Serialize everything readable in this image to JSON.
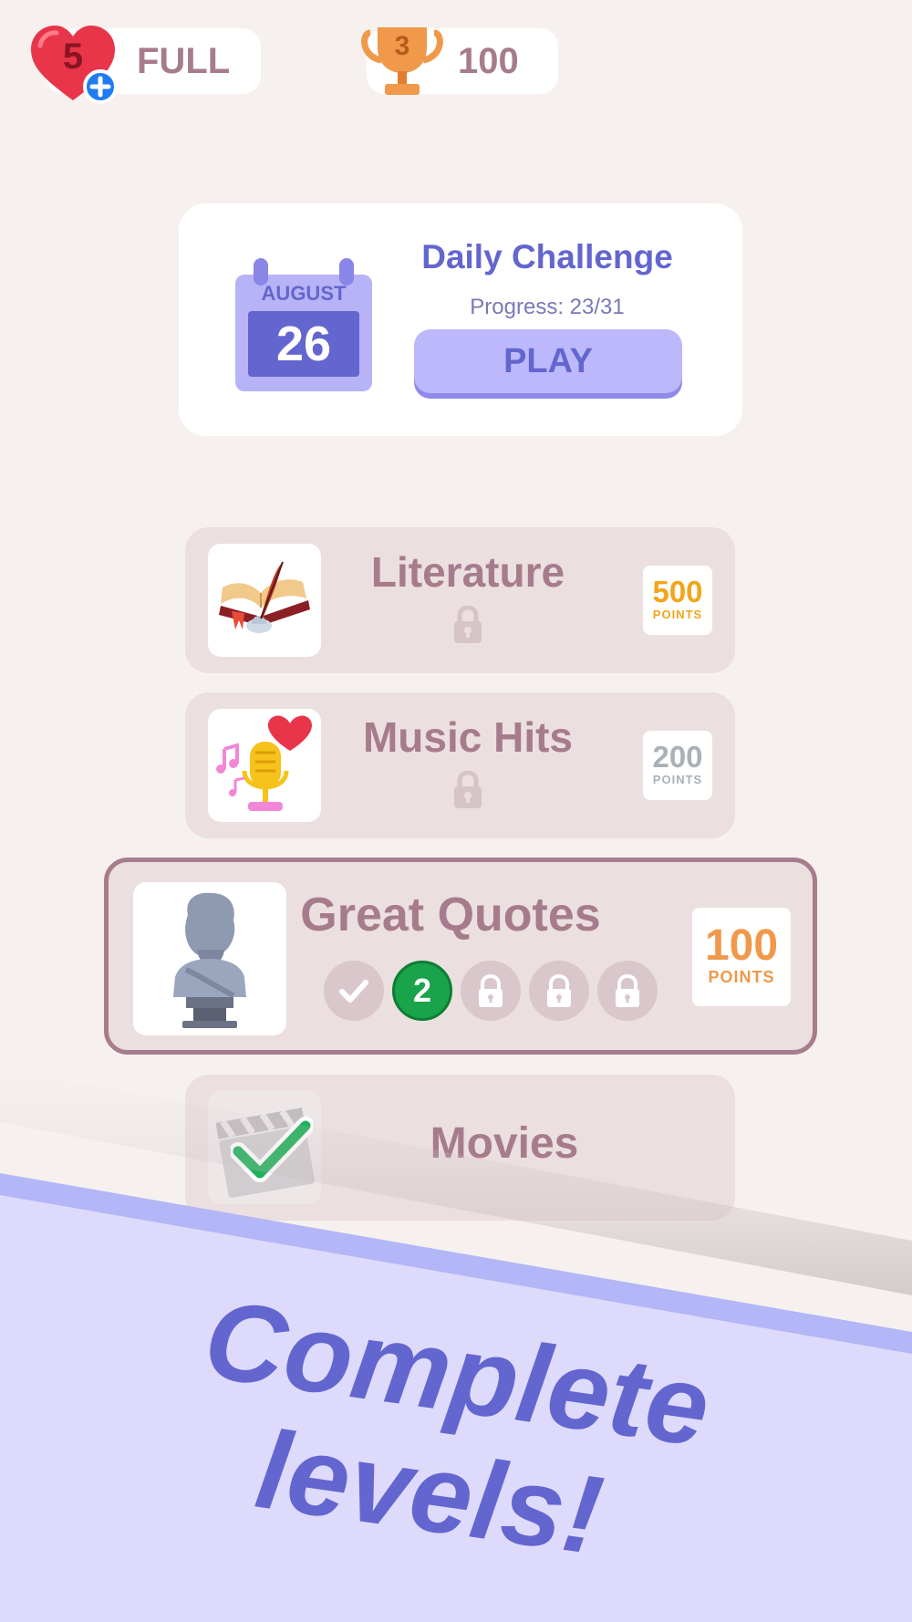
{
  "status": {
    "lives_count": "5",
    "lives_label": "FULL",
    "trophy_rank": "3",
    "score": "100"
  },
  "daily_challenge": {
    "month": "AUGUST",
    "day": "26",
    "title": "Daily Challenge",
    "progress": "Progress: 23/31",
    "play_label": "PLAY"
  },
  "levels": [
    {
      "title": "Literature",
      "points": "500",
      "points_label": "POINTS",
      "points_color": "#f2a51a",
      "state": "locked"
    },
    {
      "title": "Music Hits",
      "points": "200",
      "points_label": "POINTS",
      "points_color": "#aab0b8",
      "state": "locked"
    },
    {
      "title": "Great Quotes",
      "points": "100",
      "points_label": "POINTS",
      "points_color": "#f0994a",
      "state": "active",
      "current_step": "2"
    },
    {
      "title": "Movies",
      "state": "completed"
    }
  ],
  "banner": {
    "line1": "Complete",
    "line2": "levels!"
  },
  "colors": {
    "background": "#f6f1ee",
    "accent": "#6366cf",
    "card": "#ebdfe0",
    "title": "#a67c8c",
    "banner": "#dedafb",
    "banner_stripe": "#b3b6f7",
    "success": "#19a34a"
  }
}
